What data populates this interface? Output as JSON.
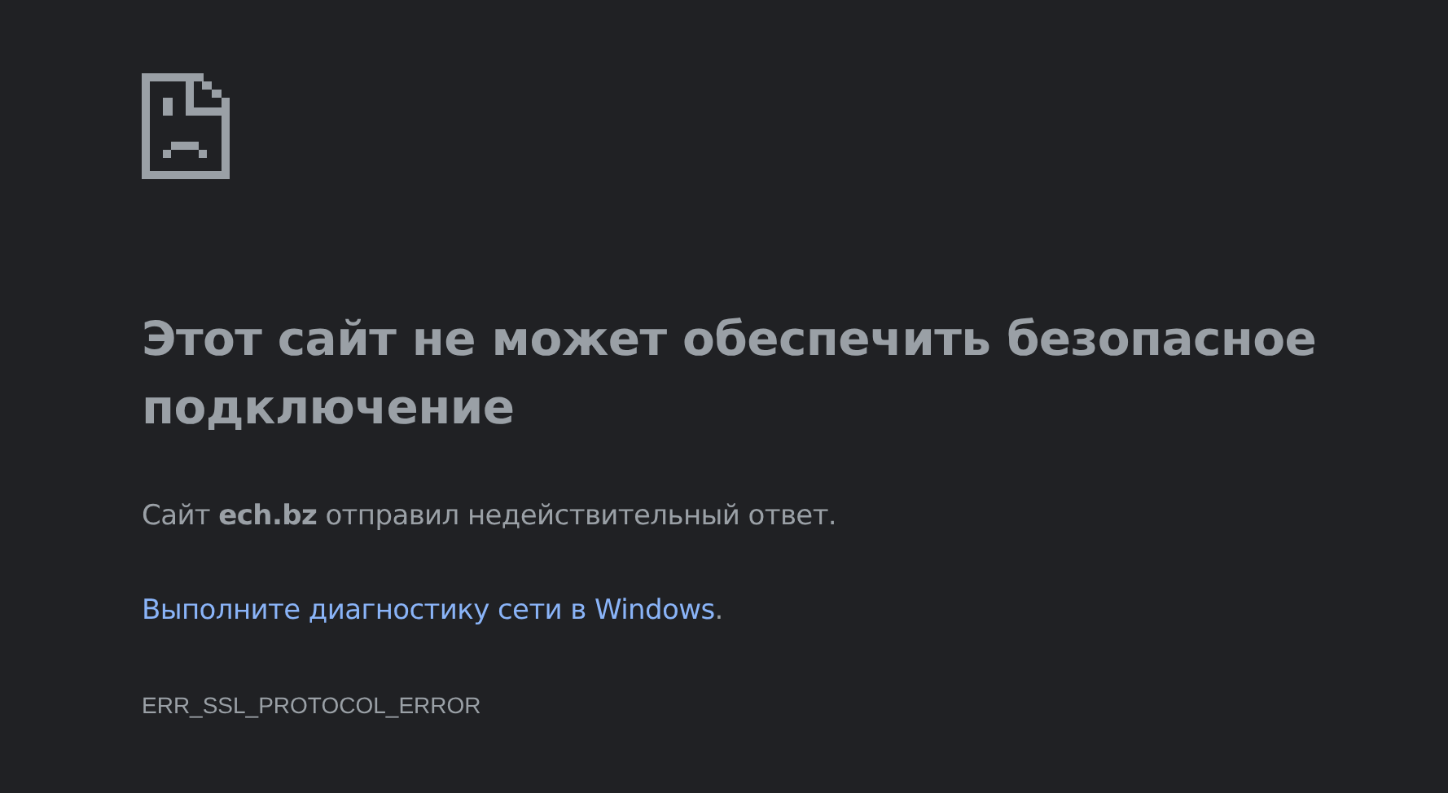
{
  "heading": "Этот сайт не может обеспечить безопасное подключение",
  "message": "Сайт **ech.bz** отправил недействительный ответ.",
  "suggestion": {
    "link": "Выполните диагностику сети в Windows",
    "after": "."
  },
  "error_code": "ERR_SSL_PROTOCOL_ERROR"
}
